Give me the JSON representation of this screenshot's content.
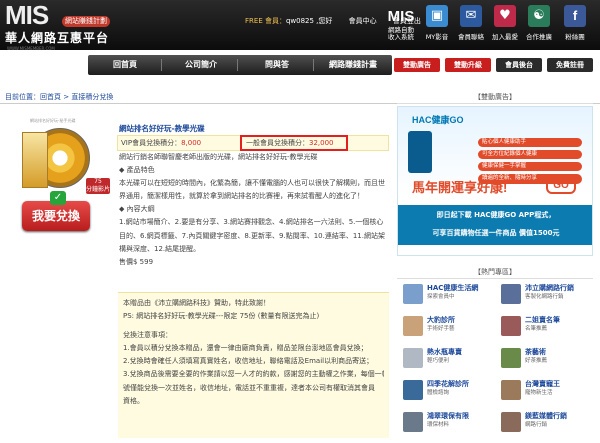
{
  "header": {
    "logo_mis": "MIS",
    "logo_tag": "網站賺錢計劃",
    "logo_cn": "華人網路互惠平台",
    "logo_url": "WWW.MISMEMBER.COM",
    "member_prefix": "FREE 會員：",
    "member_name": "qw0825 ,您好",
    "center_label": "會員中心",
    "logout_label": "會員登出",
    "mis_line1": "MIS",
    "mis_line2": "網路自動",
    "mis_line3": "收入系統",
    "icons": [
      {
        "label": "MY影音",
        "icon": "tv-icon",
        "color": "#3a8bd0"
      },
      {
        "label": "會員聯絡",
        "icon": "envelope-icon",
        "color": "#2d5a9e"
      },
      {
        "label": "加入最愛",
        "icon": "heart-icon",
        "color": "#c02a4a"
      },
      {
        "label": "合作推廣",
        "icon": "handshake-icon",
        "color": "#2b7c5a"
      },
      {
        "label": "粉絲團",
        "icon": "facebook-icon",
        "color": "#3b5998"
      }
    ]
  },
  "nav": {
    "items": [
      "回首頁",
      "公司簡介",
      "問與答",
      "網路賺錢計畫"
    ],
    "buttons": [
      {
        "label": "雙動廣告",
        "color": "#c81e1e"
      },
      {
        "label": "雙動升級",
        "color": "#c81e1e"
      },
      {
        "label": "會員後台",
        "color": "#2b2b2b"
      },
      {
        "label": "免費註冊",
        "color": "#2b2b2b"
      }
    ]
  },
  "breadcrumb": {
    "prefix": "目前位置：",
    "home": "回首頁",
    "sep": " > ",
    "current": "直接積分兌換"
  },
  "product": {
    "image_label": "網站排名好好玩-秘手光碟",
    "badge_num": "75",
    "badge_unit": "分鐘影片",
    "buy_label": "我要兌換",
    "title": "網站排名好好玩-教學光碟",
    "vip_label": "VIP會員兌換積分：",
    "vip_points": "8,000",
    "free_label": "一般會員兌換積分：",
    "free_points": "32,000",
    "desc": [
      {
        "text": "網站行銷名師聯智慶老師出版的光碟，網站排名好好玩-教學光碟",
        "link": false
      },
      {
        "text": "◆ 產品特色",
        "link": false
      },
      {
        "text": "本光碟可以在短短的時間內，化繁為簡，讓不懂電腦的人也可以很快了解構則，而且世",
        "link": false
      },
      {
        "text": "界通用，簡潔樣用性，就算於拿到網站排名的比賽裡，再來試看醒人的進化了！",
        "link": false
      },
      {
        "text": "◆ 內容大綱",
        "link": false
      },
      {
        "text": "1.網站市場簡介、2.要是有分享、3.網站賽排觀念、4.網站排名一六法則、5.一個核心",
        "link": false
      },
      {
        "text": "目的、6.網頁標籤、7.內頁關鍵字密度、8.更新率、9.點閱率、10.連結率、11.網站架",
        "link": false
      },
      {
        "text": "構與深度、12.結尾提醒。",
        "link": false
      },
      {
        "text": "售價$ 599",
        "link": false
      }
    ]
  },
  "notice": {
    "lines": [
      "本贈品由《沛立購網路科技》贊助，特此致謝！",
      "PS: 網站排名好好玩-教學光碟---限定 75份 (數量有限送完為止)",
      "",
      "兌換注意事項：",
      "1.會員以積分兌換本贈品，還會一律由廠商負責，贈品並限台澎地區會員兌換；",
      "2.兌換時會確任人須填寫真實姓名，收信地址，聯絡電話及Email以利商品寄送；",
      "3.兌換商品後需要全要的作業請以您一人才的約款，感謝您的主動權之作業，每個一帳",
      "號僅能兌換一次並姓名，收信地址，電話並不重重複，達者本公司有權取消其會員",
      "資格。"
    ]
  },
  "sidebar": {
    "ad_header": "【雙動廣告】",
    "ad_logo": "HAC健康GO",
    "ad_points": [
      "貼心個人健康助手",
      "可全方位紀錄個人健康",
      "健康保健一手掌握",
      "讀遍的全新、隨時分享"
    ],
    "ad_big": "馬年開運享好康!",
    "ad_go": "GO",
    "ad_band1": "即日起下載 HAC健康GO APP程式，",
    "ad_band2": "可享百貨購物任選一件商品 價值1500元",
    "hot_header": "【熱門專區】",
    "hot": [
      {
        "title": "HAC健康生活網",
        "sub": "探索會員中",
        "icon": "doctor-icon",
        "color": "#7a9fcc"
      },
      {
        "title": "沛立購網路行銷",
        "sub": "客製化網路行銷",
        "icon": "pcl-logo-icon",
        "color": "#5a6f9a"
      },
      {
        "title": "大豹診所",
        "sub": "手術好手藝",
        "icon": "clinic-icon",
        "color": "#c9a27a"
      },
      {
        "title": "二姐賣名筆",
        "sub": "名筆推薦",
        "icon": "pen-icon",
        "color": "#9a5a5a"
      },
      {
        "title": "熱水瓶專賣",
        "sub": "輕巧便利",
        "icon": "bottle-icon",
        "color": "#b0b8c4"
      },
      {
        "title": "茶藝術",
        "sub": "好茶推薦",
        "icon": "tea-icon",
        "color": "#6a8a4a"
      },
      {
        "title": "四季花解診所",
        "sub": "體檢諮詢",
        "icon": "flower-icon",
        "color": "#3a6a9a"
      },
      {
        "title": "台灣賣寵王",
        "sub": "寵物新生活",
        "icon": "dog-icon",
        "color": "#9a7a5a"
      },
      {
        "title": "鴻翠環保有限",
        "sub": "環保材料",
        "icon": "building-icon",
        "color": "#6a7a8a"
      },
      {
        "title": "鎂藍媒體行銷",
        "sub": "網路行銷",
        "icon": "person-icon",
        "color": "#8a6a5a"
      }
    ]
  }
}
